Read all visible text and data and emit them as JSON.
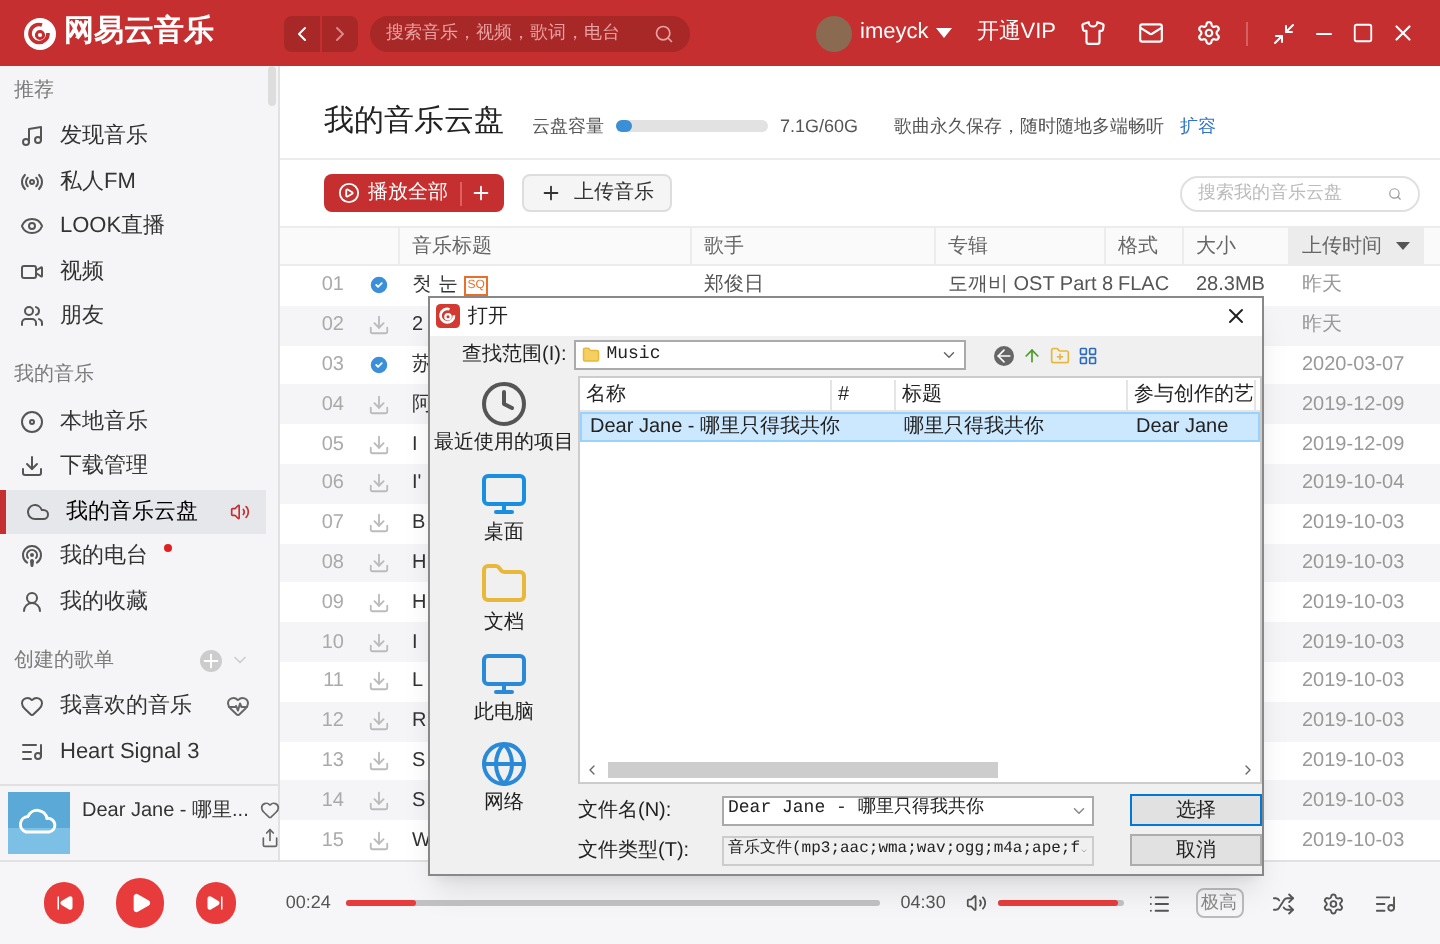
{
  "app": {
    "logo": "网易云音乐",
    "search_placeholder": "搜索音乐，视频，歌词，电台",
    "username": "imeyck",
    "vip": "开通VIP"
  },
  "sidebar": {
    "sections": [
      {
        "title": "推荐",
        "items": [
          {
            "label": "发现音乐",
            "selected": false,
            "new": false
          },
          {
            "label": "私人FM",
            "selected": false,
            "new": false
          },
          {
            "label": "LOOK直播",
            "selected": false,
            "new": false
          },
          {
            "label": "视频",
            "selected": false,
            "new": false
          },
          {
            "label": "朋友",
            "selected": false,
            "new": false
          }
        ]
      },
      {
        "title": "我的音乐",
        "items": [
          {
            "label": "本地音乐",
            "selected": false,
            "new": false
          },
          {
            "label": "下载管理",
            "selected": false,
            "new": false
          },
          {
            "label": "我的音乐云盘",
            "selected": true,
            "new": false
          },
          {
            "label": "我的电台",
            "selected": false,
            "new": true
          },
          {
            "label": "我的收藏",
            "selected": false,
            "new": false
          }
        ]
      },
      {
        "title": "创建的歌单",
        "items": [
          {
            "label": "我喜欢的音乐",
            "selected": false,
            "new": false
          },
          {
            "label": "Heart Signal 3",
            "selected": false,
            "new": false
          }
        ]
      }
    ]
  },
  "now_playing": {
    "title": "Dear Jane - 哪里..."
  },
  "page": {
    "title": "我的音乐云盘",
    "capacity_label": "云盘容量",
    "capacity": {
      "level": 0.1
    },
    "capacity_text": "7.1G/60G",
    "note": "歌曲永久保存，随时随地多端畅听",
    "expand_link": "扩容",
    "play_all": "播放全部",
    "upload": "上传音乐",
    "search_placeholder": "搜索我的音乐云盘"
  },
  "table": {
    "columns": [
      {
        "label": "音乐标题",
        "sorted": false
      },
      {
        "label": "歌手",
        "sorted": false
      },
      {
        "label": "专辑",
        "sorted": false
      },
      {
        "label": "格式",
        "sorted": false
      },
      {
        "label": "大小",
        "sorted": false
      },
      {
        "label": "上传时间",
        "sorted": true
      }
    ],
    "rows": [
      {
        "index": "01",
        "downloaded": true,
        "title": "첫 눈",
        "badge": "SQ",
        "singer": "郑俊日",
        "album": "도깨비 OST Part 8",
        "format": "FLAC",
        "size": "28.3MB",
        "time": "昨天"
      },
      {
        "index": "02",
        "downloaded": false,
        "title": "2",
        "time": "昨天"
      },
      {
        "index": "03",
        "downloaded": true,
        "title": "苏",
        "time": "2020-03-07"
      },
      {
        "index": "04",
        "downloaded": false,
        "title": "阿",
        "time": "2019-12-09"
      },
      {
        "index": "05",
        "downloaded": false,
        "title": "I",
        "time": "2019-12-09"
      },
      {
        "index": "06",
        "downloaded": false,
        "title": "I'",
        "time": "2019-10-04"
      },
      {
        "index": "07",
        "downloaded": false,
        "title": "B",
        "time": "2019-10-03"
      },
      {
        "index": "08",
        "downloaded": false,
        "title": "H",
        "time": "2019-10-03"
      },
      {
        "index": "09",
        "downloaded": false,
        "title": "H",
        "time": "2019-10-03"
      },
      {
        "index": "10",
        "downloaded": false,
        "title": "I",
        "time": "2019-10-03"
      },
      {
        "index": "11",
        "downloaded": false,
        "title": "L",
        "time": "2019-10-03"
      },
      {
        "index": "12",
        "downloaded": false,
        "title": "R",
        "time": "2019-10-03"
      },
      {
        "index": "13",
        "downloaded": false,
        "title": "S",
        "time": "2019-10-03"
      },
      {
        "index": "14",
        "downloaded": false,
        "title": "S",
        "time": "2019-10-03"
      },
      {
        "index": "15",
        "downloaded": false,
        "title": "W",
        "time": "2019-10-03"
      }
    ]
  },
  "dialog": {
    "title": "打开",
    "look_in_label": "查找范围(I):",
    "look_in_value": "Music",
    "places": [
      "最近使用的项目",
      "桌面",
      "文档",
      "此电脑",
      "网络"
    ],
    "columns": [
      "名称",
      "#",
      "标题",
      "参与创作的艺"
    ],
    "files": [
      {
        "name": "Dear Jane - 哪里只得我共你",
        "title": "哪里只得我共你",
        "artist": "Dear Jane",
        "selected": true
      }
    ],
    "filename_label": "文件名(N):",
    "filename": "Dear Jane - 哪里只得我共你",
    "filetype_label": "文件类型(T):",
    "filetype": "音乐文件(mp3;aac;wma;wav;ogg;m4a;ape;f",
    "buttons": [
      "选择",
      "取消"
    ]
  },
  "player": {
    "elapsed": "00:24",
    "duration": "04:30",
    "progress": {
      "level": 0.13
    },
    "volume": {
      "level": 0.95
    },
    "quality": "极高"
  }
}
